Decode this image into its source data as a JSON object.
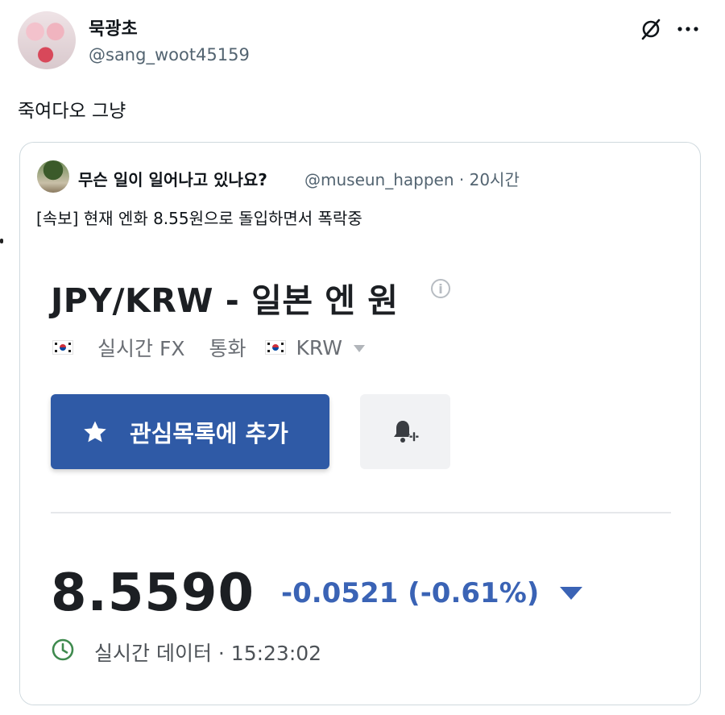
{
  "post": {
    "display_name": "묵광초",
    "handle": "@sang_woot45159",
    "text": "죽여다오 그냥",
    "header_icons": [
      "grok-slash-icon",
      "more-icon"
    ]
  },
  "quote": {
    "display_name": "무슨 일이 일어나고 있나요?",
    "handle_time": "@museun_happen · 20시간",
    "text": "[속보] 현재 엔화 8.55원으로 돌입하면서 폭락중"
  },
  "screenshot": {
    "pair_title": "JPY/KRW - 일본 엔 원",
    "info_icon_glyph": "i",
    "meta_realtime": "실시간 FX",
    "meta_currency_label": "통화",
    "meta_currency": "KRW",
    "watchlist_button": "관심목록에 추가",
    "price": "8.5590",
    "change": "-0.0521 (-0.61%)",
    "data_line": "실시간 데이터 · 15:23:02",
    "colors": {
      "button_blue": "#2f5aa6",
      "change_blue": "#3a63b5"
    }
  }
}
